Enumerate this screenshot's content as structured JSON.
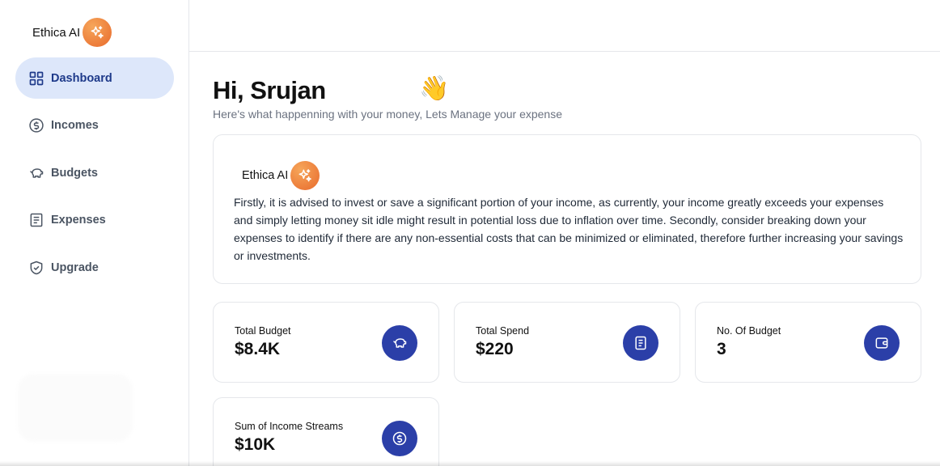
{
  "brand": {
    "name": "Ethica AI",
    "icon": "sparkles-icon",
    "badge_color": "#e8742f"
  },
  "sidebar": {
    "items": [
      {
        "label": "Dashboard",
        "icon": "dashboard-icon",
        "active": true
      },
      {
        "label": "Incomes",
        "icon": "dollar-circle-icon",
        "active": false
      },
      {
        "label": "Budgets",
        "icon": "piggy-bank-icon",
        "active": false
      },
      {
        "label": "Expenses",
        "icon": "receipt-icon",
        "active": false
      },
      {
        "label": "Upgrade",
        "icon": "shield-check-icon",
        "active": false
      }
    ]
  },
  "main": {
    "greeting": "Hi, Srujan",
    "wave_emoji": "👋",
    "subtitle": "Here's what happenning with your money, Lets Manage your expense",
    "advice": {
      "title": "Ethica AI",
      "text": "Firstly, it is advised to invest or save a significant portion of your income, as currently, your income greatly exceeds your expenses and simply letting money sit idle might result in potential loss due to inflation over time. Secondly, consider breaking down your expenses to identify if there are any non-essential costs that can be minimized or eliminated, therefore further increasing your savings or investments."
    },
    "stats": [
      {
        "label": "Total Budget",
        "value": "$8.4K",
        "icon": "piggy-bank-icon"
      },
      {
        "label": "Total Spend",
        "value": "$220",
        "icon": "receipt-icon"
      },
      {
        "label": "No. Of Budget",
        "value": "3",
        "icon": "wallet-icon"
      },
      {
        "label": "Sum of Income Streams",
        "value": "$10K",
        "icon": "dollar-circle-icon"
      }
    ]
  },
  "colors": {
    "accent": "#2b3fa8",
    "active_nav_bg": "#dde7fa",
    "active_nav_text": "#1e3a8a"
  }
}
